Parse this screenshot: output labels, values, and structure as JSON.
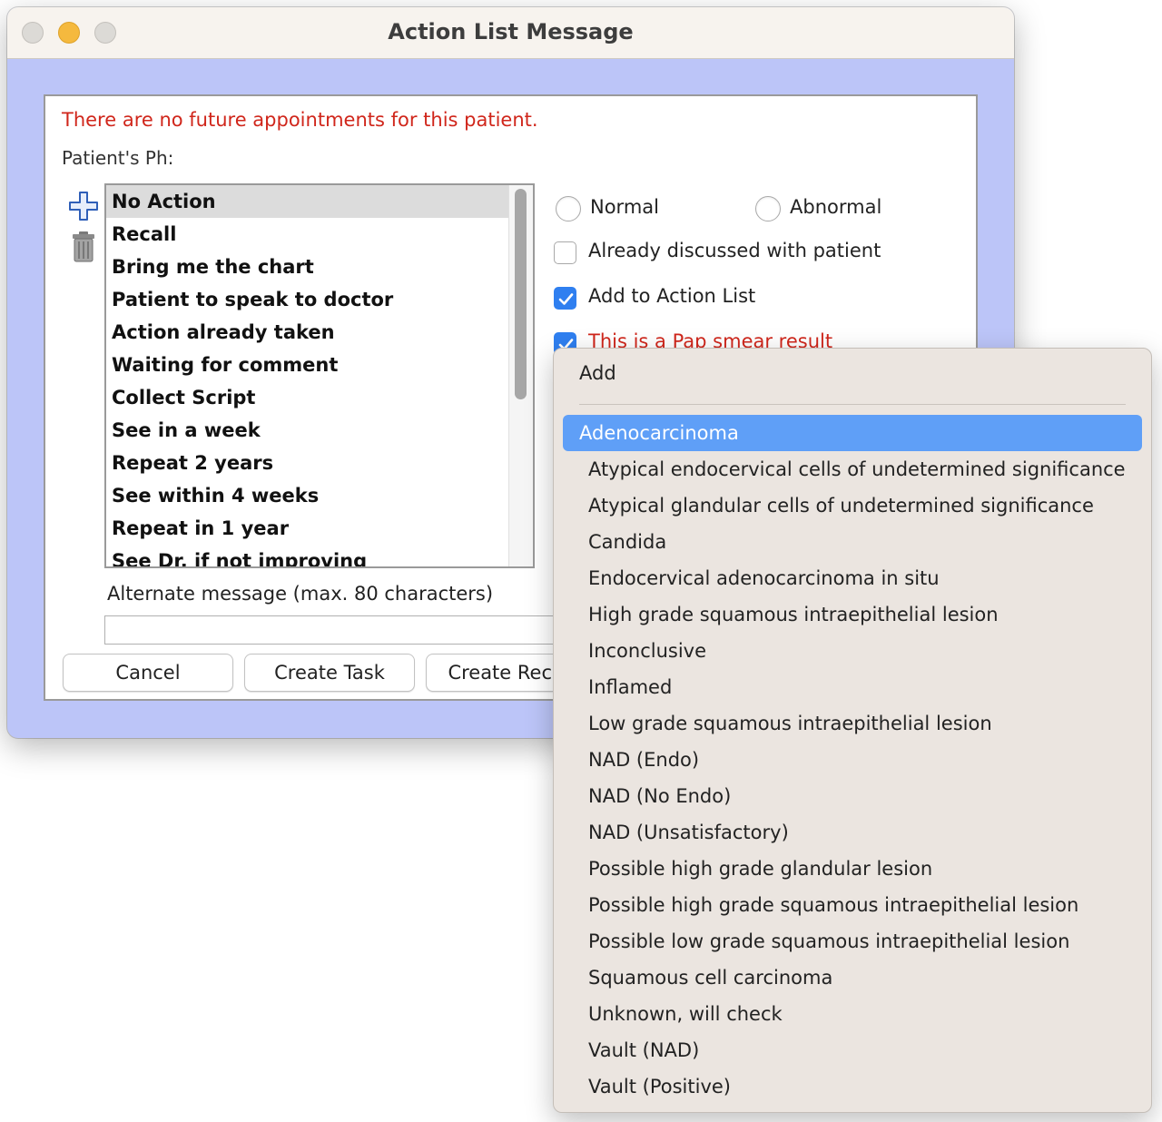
{
  "window": {
    "title": "Action List Message"
  },
  "messages": {
    "no_appointments": "There are no future appointments for this patient.",
    "patient_phone_label": "Patient's Ph:"
  },
  "action_list": {
    "items": [
      "No Action",
      "Recall",
      "Bring me the chart",
      "Patient to speak to doctor",
      "Action already taken",
      "Waiting for comment",
      "Collect Script",
      "See in a week",
      "Repeat 2 years",
      "See within 4 weeks",
      "Repeat in 1 year",
      "See Dr. if not improving"
    ],
    "selected": "No Action",
    "icons": [
      "plus-icon",
      "trash-icon"
    ]
  },
  "options": {
    "radio_normal": "Normal",
    "radio_abnormal": "Abnormal",
    "already_discussed": "Already discussed with patient",
    "already_discussed_checked": false,
    "add_to_action_list": "Add to Action List",
    "add_to_action_list_checked": true,
    "pap_smear": "This is a Pap smear result",
    "pap_smear_checked": true
  },
  "alternate": {
    "label": "Alternate message (max. 80 characters)",
    "value": ""
  },
  "buttons": {
    "cancel": "Cancel",
    "create_task": "Create Task",
    "create_recall": "Create Recall"
  },
  "pap_menu": {
    "header": "Add",
    "highlighted": "Adenocarcinoma",
    "items": [
      "Adenocarcinoma",
      "Atypical endocervical cells of undetermined significance",
      "Atypical glandular cells of undetermined significance",
      "Candida",
      "Endocervical adenocarcinoma in situ",
      "High grade squamous intraepithelial lesion",
      "Inconclusive",
      "Inflamed",
      "Low grade squamous intraepithelial lesion",
      "NAD (Endo)",
      "NAD (No Endo)",
      "NAD (Unsatisfactory)",
      "Possible high grade glandular lesion",
      "Possible high grade squamous intraepithelial lesion",
      "Possible low grade squamous intraepithelial lesion",
      "Squamous cell carcinoma",
      "Unknown, will check",
      "Vault (NAD)",
      "Vault (Positive)"
    ]
  },
  "colors": {
    "window_background": "#bcc5f8",
    "warning_text": "#d0261b",
    "accent": "#2f7ff0",
    "menu_highlight": "#5f9ff7",
    "menu_background": "#ebe5e0"
  }
}
